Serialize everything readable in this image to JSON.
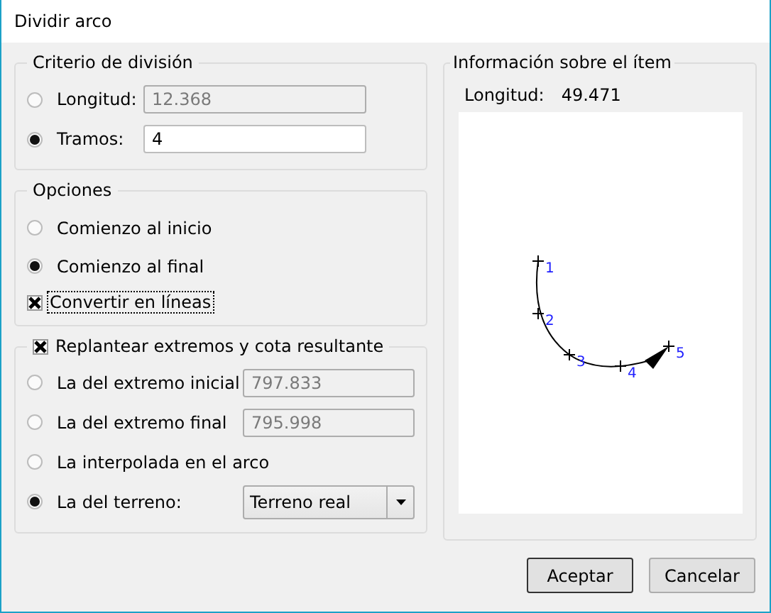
{
  "window": {
    "title": "Dividir arco"
  },
  "criterion": {
    "legend": "Criterio de división",
    "options": [
      {
        "label": "Longitud:",
        "selected": false,
        "value": "12.368",
        "disabled": true
      },
      {
        "label": "Tramos:",
        "selected": true,
        "value": "4",
        "disabled": false
      }
    ]
  },
  "options": {
    "legend": "Opciones",
    "items": [
      {
        "kind": "radio",
        "label": "Comienzo al inicio",
        "selected": false
      },
      {
        "kind": "radio",
        "label": "Comienzo al final",
        "selected": true
      },
      {
        "kind": "checkbox",
        "label": "Convertir en líneas",
        "checked": true,
        "focused": true
      }
    ]
  },
  "stakeout": {
    "legend": "Replantear extremos y cota resultante",
    "checked": true,
    "options": [
      {
        "kind": "field",
        "label": "La del extremo inicial",
        "selected": false,
        "value": "797.833"
      },
      {
        "kind": "field",
        "label": "La del extremo final",
        "selected": false,
        "value": "795.998"
      },
      {
        "kind": "plain",
        "label": "La interpolada en el arco",
        "selected": false
      },
      {
        "kind": "dropdown",
        "label": "La del terreno:",
        "selected": true,
        "value": "Terreno real"
      }
    ]
  },
  "info": {
    "legend": "Información sobre el ítem",
    "length_label": "Longitud:",
    "length_value": "49.471",
    "points": [
      "1",
      "2",
      "3",
      "4",
      "5"
    ]
  },
  "buttons": [
    "Aceptar",
    "Cancelar"
  ]
}
